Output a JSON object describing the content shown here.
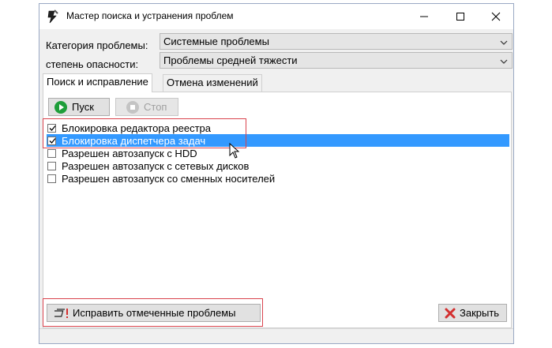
{
  "window": {
    "title": "Мастер поиска и устранения проблем"
  },
  "filters": {
    "category_label": "Категория проблемы:",
    "category_value": "Системные проблемы",
    "severity_label": "степень опасности:",
    "severity_value": "Проблемы средней тяжести"
  },
  "tabs": [
    {
      "label": "Поиск и исправление",
      "active": true
    },
    {
      "label": "Отмена изменений",
      "active": false
    }
  ],
  "toolbar": {
    "start_label": "Пуск",
    "stop_label": "Стоп"
  },
  "problems": [
    {
      "label": "Блокировка редактора реестра",
      "checked": true,
      "selected": false
    },
    {
      "label": "Блокировка диспетчера задач",
      "checked": true,
      "selected": true
    },
    {
      "label": "Разрешен автозапуск с HDD",
      "checked": false,
      "selected": false
    },
    {
      "label": "Разрешен автозапуск с сетевых дисков",
      "checked": false,
      "selected": false
    },
    {
      "label": "Разрешен автозапуск со сменных носителей",
      "checked": false,
      "selected": false
    }
  ],
  "footer": {
    "fix_label": "Исправить отмеченные проблемы",
    "close_label": "Закрыть"
  },
  "colors": {
    "selection": "#3399ff",
    "highlight_box": "#d9434d",
    "start_green": "#1e9e3a",
    "close_red": "#d32f2f"
  }
}
